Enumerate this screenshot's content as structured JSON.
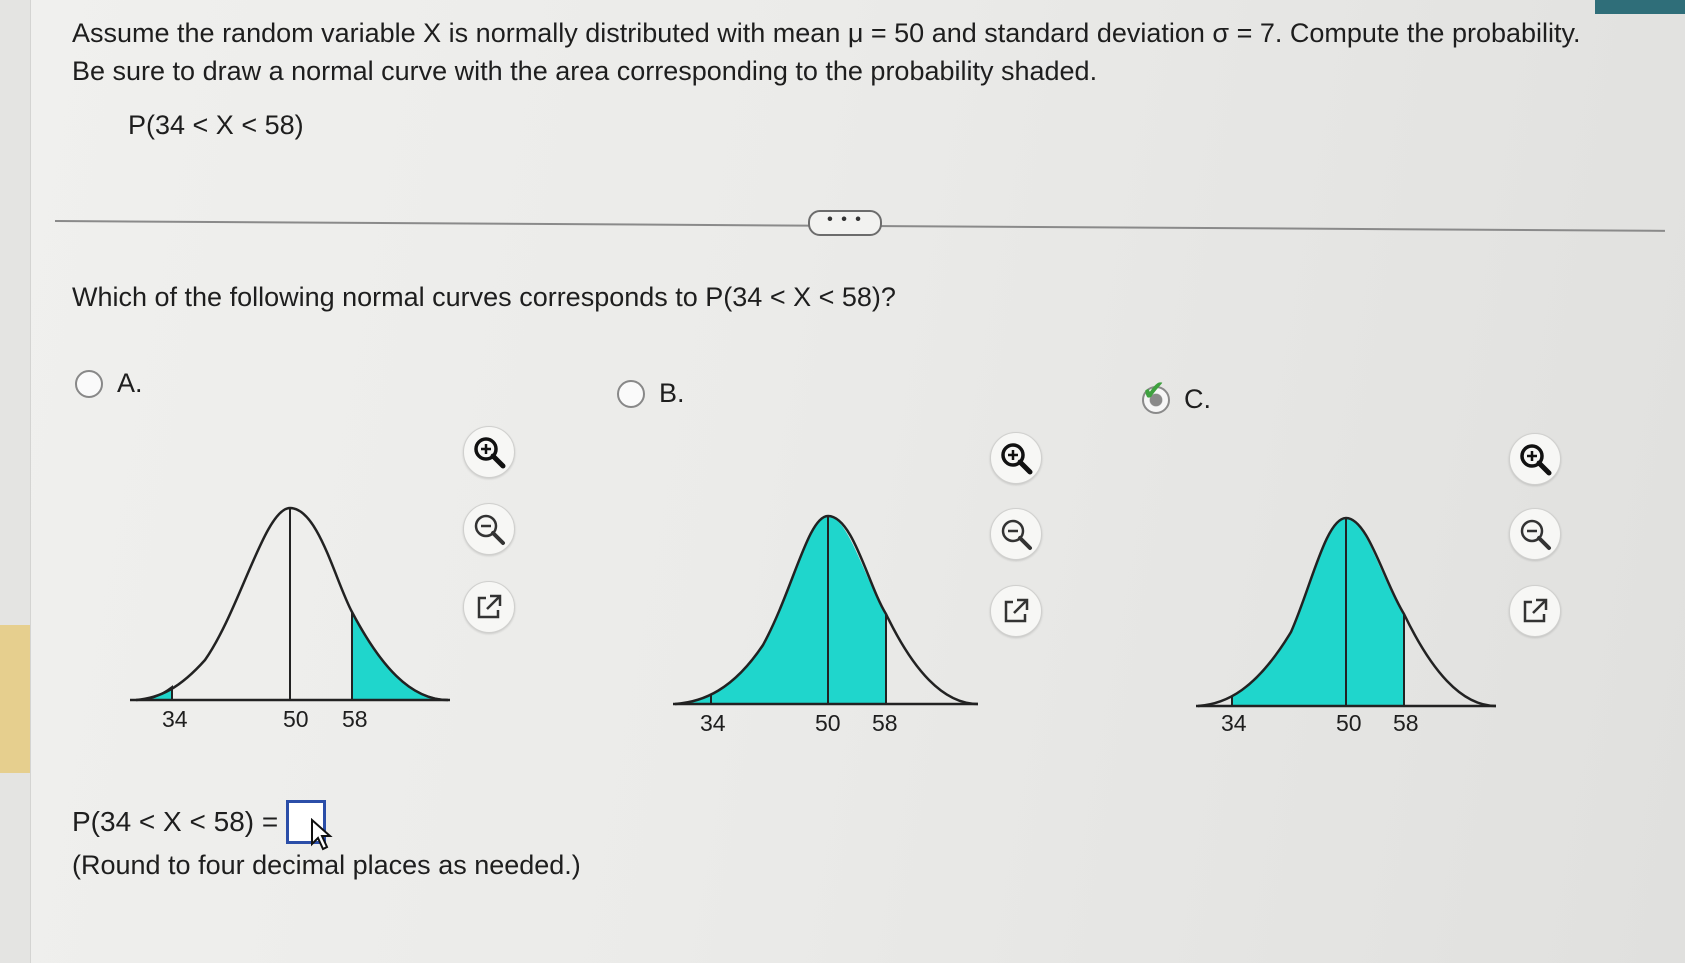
{
  "problem": {
    "statement": "Assume the random variable X is normally distributed with mean μ = 50 and standard deviation σ = 7. Compute the probability. Be sure to draw a normal curve with the area corresponding to the probability shaded.",
    "expression": "P(34 < X < 58)"
  },
  "more_label": "• • •",
  "question": "Which of the following normal curves corresponds to P(34 < X < 58)?",
  "options": [
    {
      "letter": "A.",
      "selected": false,
      "ticks": [
        "34",
        "50",
        "58"
      ]
    },
    {
      "letter": "B.",
      "selected": false,
      "ticks": [
        "34",
        "50",
        "58"
      ]
    },
    {
      "letter": "C.",
      "selected": true,
      "ticks": [
        "34",
        "50",
        "58"
      ]
    }
  ],
  "answer": {
    "label": "P(34 < X < 58) =",
    "value": "",
    "note": "(Round to four decimal places as needed.)"
  },
  "icons": [
    "zoom-in-icon",
    "zoom-out-icon",
    "external-link-icon"
  ],
  "colors": {
    "shade": "#1fd6cc",
    "accent": "#2b4ea8",
    "check": "#3fa13f"
  }
}
